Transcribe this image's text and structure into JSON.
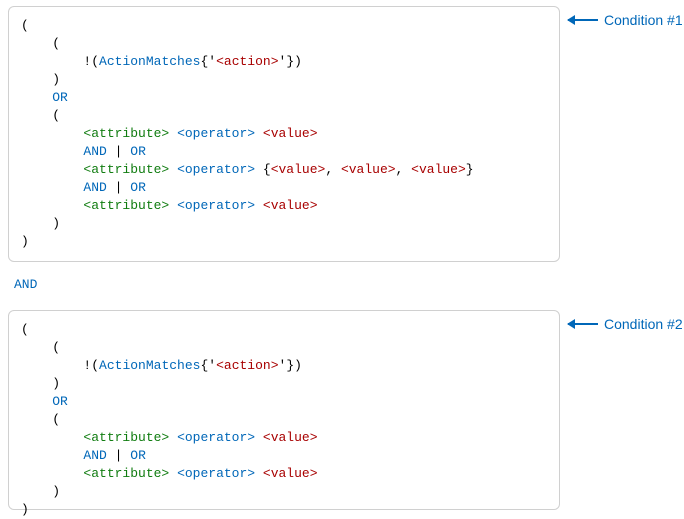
{
  "punct": {
    "open": "(",
    "close": ")",
    "neg": "!",
    "quote": "'",
    "comma": ",",
    "set_open": "{",
    "set_close": "}",
    "pipe": "|"
  },
  "keywords": {
    "ActionMatches": "ActionMatches",
    "OR": "OR",
    "AND": "AND"
  },
  "placeholders": {
    "action": "<action>",
    "attribute": "<attribute>",
    "operator": "<operator>",
    "value": "<value>"
  },
  "callouts": {
    "c1": "Condition #1",
    "c2": "Condition #2"
  }
}
